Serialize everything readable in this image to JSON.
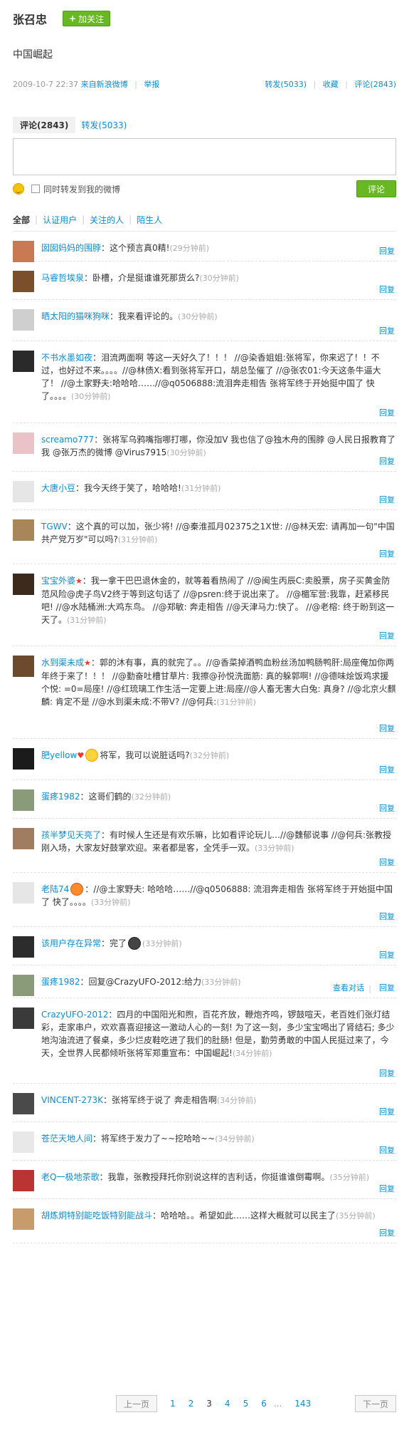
{
  "header": {
    "author": "张召忠",
    "follow_label": "加关注",
    "post": "中国崛起",
    "timestamp": "2009-10-7 22:37",
    "source": "来自新浪微博",
    "report": "举报",
    "repost": "转发(5033)",
    "favorite": "收藏",
    "comments": "评论(2843)"
  },
  "compose": {
    "tab_comment": "评论",
    "tab_comment_count": "(2843)",
    "tab_repost": "转发(5033)",
    "also_repost_label": "同时转发到我的微博",
    "submit_label": "评论"
  },
  "filters": {
    "all": "全部",
    "verified": "认证用户",
    "followed": "关注的人",
    "strangers": "陌生人"
  },
  "reply_label": "回复",
  "view_conversation": "查看对话",
  "comments": [
    {
      "user": "囡囡妈妈的围脖",
      "body": "：这个预言真0精!",
      "time": "(29分钟前)"
    },
    {
      "user": "马睿哲埃泉",
      "body": "：卧槽，介是挺谁谁死那货么?",
      "time": "(30分钟前)"
    },
    {
      "user": "晒太阳的猫咪狗咪",
      "body": "：我来看评论的。",
      "time": "(30分钟前)"
    },
    {
      "user": "不书水墨如夜",
      "body": "：泪流两面啊 等这一天好久了！！！ //@染香姐姐:张将军，你来迟了！！不过，也好过不来。。。。//@林债X:看到张将军开口，胡总坠催了 //@张农01:今天这条牛逼大了！ //@土家野夫:哈哈哈……//@q0506888:流泪奔走相告 张将军终于开始挺中国了 快了。。。。",
      "time": "(30分钟前)"
    },
    {
      "user": "screamo777",
      "body": "：张将军乌鸦嘴指哪打哪，你没加V 我也信了@独木舟的围脖 @人民日报教育了我 @张万杰的微博 @Virus7915",
      "time": "(30分钟前)"
    },
    {
      "user": "大唐小豆",
      "body": "：我今天终于笑了，哈哈哈!",
      "time": "(31分钟前)"
    },
    {
      "user": "TGWV",
      "body": "：这个真的可以加，张少将! //@秦淮孤月02375之1X世: //@林天宏: 请再加一句\"中国共产党万岁\"可以吗?",
      "time": "(31分钟前)"
    },
    {
      "user": "宝宝外婆",
      "body": "：我一拿干巴巴退休金的，就等着看热闹了 //@闽生丙辰C:卖股票，房子买黄金防范风险@虎子鸟V2终于等到这句话了 //@psren:终于说出来了。 //@楣军营:我靠，赶紧移民吧! //@水陆桶洲:大鸡东鸟。 //@郑敏: 奔走相告 //@天津马力:快了。 //@老榕: 终于盼到这一天了。",
      "time": "(31分钟前)"
    },
    {
      "user": "水到渠未成",
      "body": "：郭的沐有事，真的就完了。。//@香菜掉酒鸭血粉丝汤加鸭肠鸭肝:局座俺加你两年终于来了！！！ //@勤奋吐槽甘草片: 我擦@孙悦洗面筋: 真的躲郭啊! //@德味烩饭鸡求援个悦: =0=局座! //@红琉璃工作生活一定要上进:局座//@人畜无害大白兔: 真身? //@北京火麒麟: 肯定不是 //@水到渠未成:不带V? //@何兵:",
      "time": "(31分钟前)"
    },
    {
      "user": "肥yellow",
      "body": "将军，我可以说脏话吗?",
      "time": "(32分钟前)"
    },
    {
      "user": "蛋疼1982",
      "body": "：这哥们鹤的",
      "time": "(32分钟前)"
    },
    {
      "user": "孩半梦见天亮了",
      "body": "：有时候人生还是有欢乐嘛，比如看评论玩儿…//@魏郁说事 //@何兵:张教授刚入场，大家友好鼓掌欢迎。来者都是客，全凭手一双。",
      "time": "(33分钟前)"
    },
    {
      "user": "老陆74",
      "body": "：//@土家野夫: 哈哈哈……//@q0506888: 流泪奔走相告 张将军终于开始挺中国了 快了。。。。",
      "time": "(33分钟前)"
    },
    {
      "user": "该用户存在异常",
      "body": "：完了",
      "time": "(33分钟前)"
    },
    {
      "user": "蛋疼1982",
      "body": "：回复@CrazyUFO-2012:给力",
      "time": "(33分钟前)"
    },
    {
      "user": "CrazyUFO-2012",
      "body": "：四月的中国阳光和煦，百花齐放，鞭炮齐鸣，锣鼓喧天，老百姓们张灯结彩，走家串户，欢欢喜喜迎接这一激动人心的一刻! 为了这一刻，多少宝宝喝出了肾结石; 多少地沟油流进了餐桌，多少烂皮鞋吃进了我们的肚肠! 但是，勤劳勇敢的中国人民挺过来了，今天，全世界人民都倾听张将军郑重宣布：中国崛起!",
      "time": "(34分钟前)"
    },
    {
      "user": "VINCENT-273K",
      "body": "：张将军终于说了 奔走相告啊",
      "time": "(34分钟前)"
    },
    {
      "user": "苍茫天地人间",
      "body": "：将军终于发力了~~挖哈哈~~",
      "time": "(34分钟前)"
    },
    {
      "user": "老Q一极地茶歌",
      "body": "：我靠，张教授拜托你别说这样的吉利话，你挺谁谁倒霉啊。",
      "time": "(35分钟前)"
    },
    {
      "user": "胡炼炯特别能吃饭特别能战斗",
      "body": "：哈哈哈。。希望如此……这样大概就可以民主了",
      "time": "(35分钟前)"
    }
  ],
  "pagination": {
    "prev": "上一页",
    "pages": [
      "1",
      "2",
      "3",
      "4",
      "5",
      "6"
    ],
    "ellipsis": "...",
    "last": "143",
    "next": "下一页"
  }
}
